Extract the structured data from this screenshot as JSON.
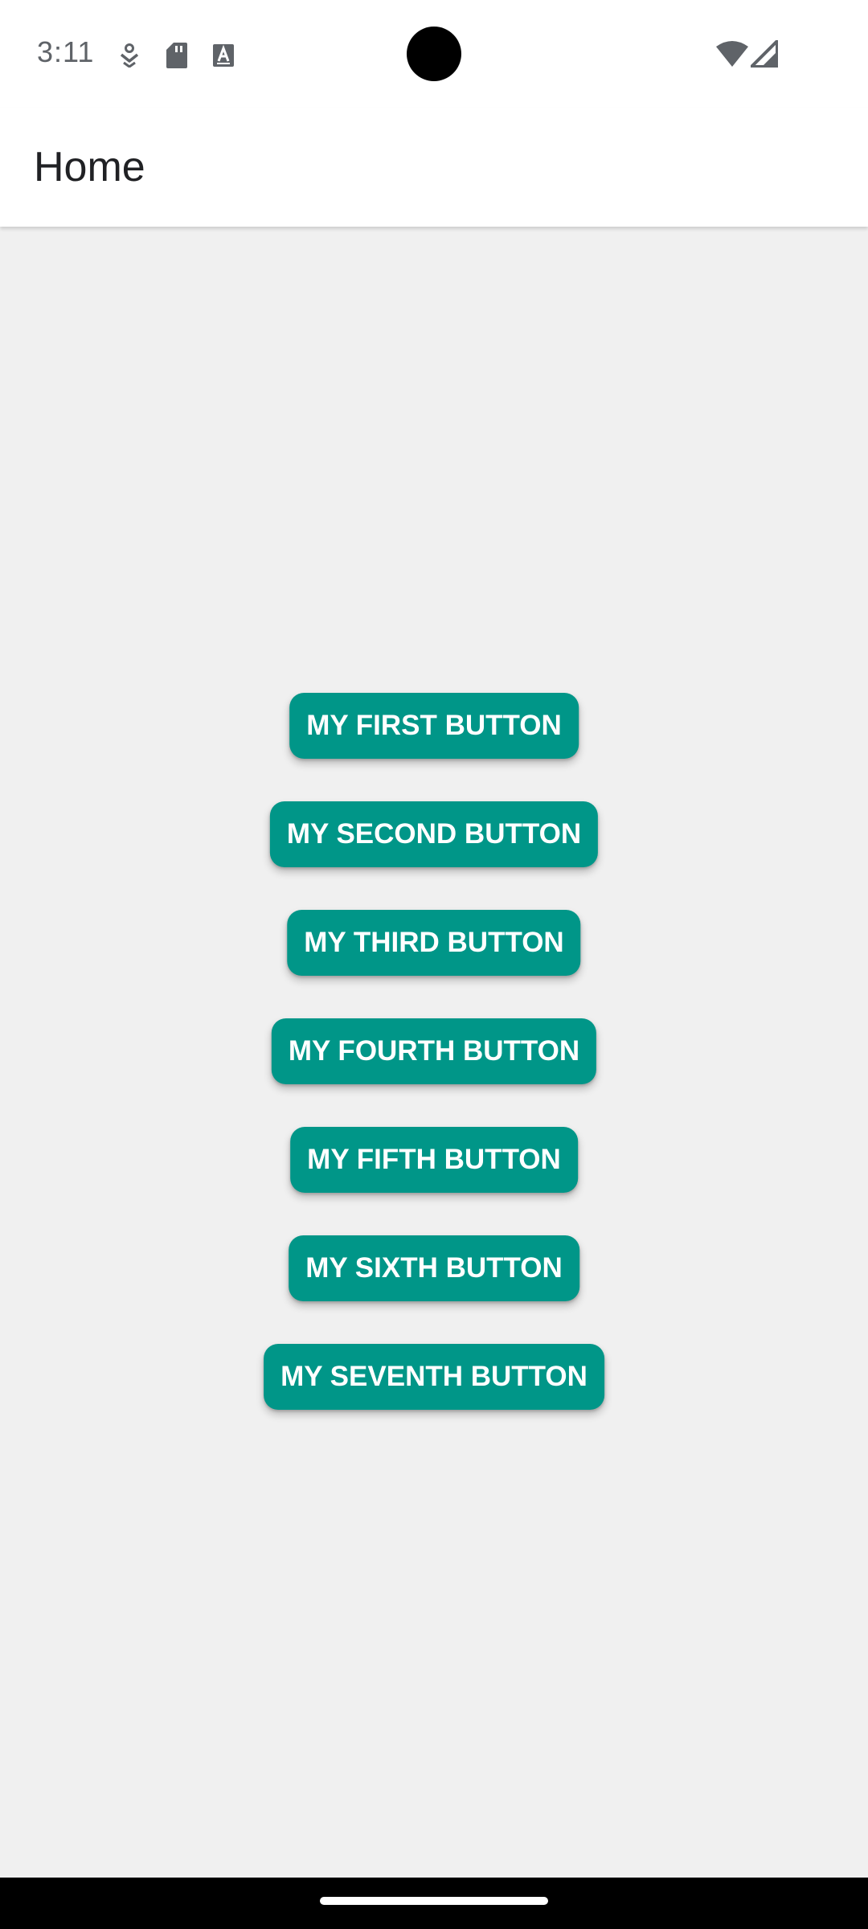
{
  "status_bar": {
    "time": "3:11",
    "icons": [
      "download-status-icon",
      "sd-card-icon",
      "text-a-icon",
      "wifi-icon",
      "cell-signal-icon"
    ]
  },
  "app_bar": {
    "title": "Home"
  },
  "buttons": [
    {
      "label": "MY FIRST BUTTON"
    },
    {
      "label": "MY SECOND BUTTON"
    },
    {
      "label": "MY THIRD BUTTON"
    },
    {
      "label": "MY FOURTH BUTTON"
    },
    {
      "label": "MY FIFTH BUTTON"
    },
    {
      "label": "MY SIXTH BUTTON"
    },
    {
      "label": "MY SEVENTH BUTTON"
    }
  ],
  "colors": {
    "button": "#009688",
    "button_text": "#ffffff",
    "background": "#f0f0f0",
    "app_bar": "#ffffff"
  }
}
